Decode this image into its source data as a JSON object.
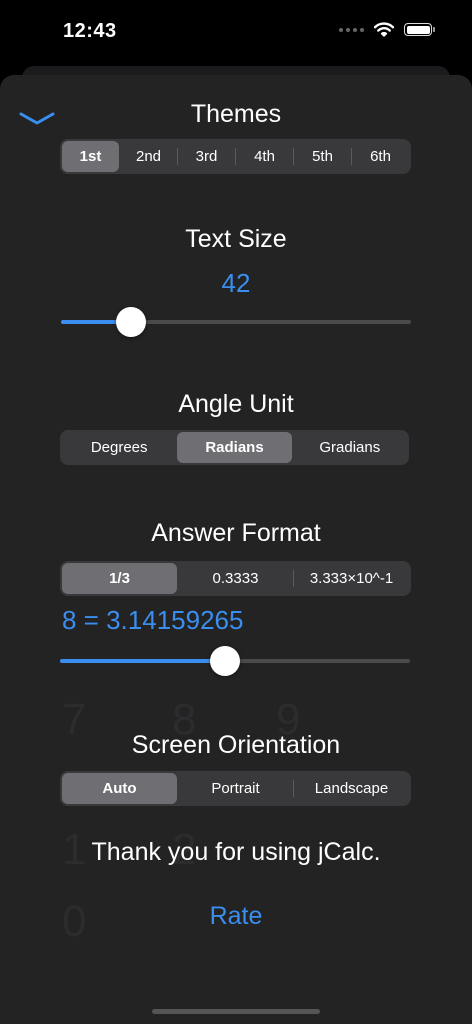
{
  "status_bar": {
    "time": "12:43"
  },
  "themes": {
    "title": "Themes",
    "options": [
      "1st",
      "2nd",
      "3rd",
      "4th",
      "5th",
      "6th"
    ],
    "selected_index": 0
  },
  "text_size": {
    "title": "Text Size",
    "value": "42",
    "slider_fraction": 0.2
  },
  "angle_unit": {
    "title": "Angle Unit",
    "options": [
      "Degrees",
      "Radians",
      "Gradians"
    ],
    "selected_index": 1
  },
  "answer_format": {
    "title": "Answer Format",
    "options": [
      "1/3",
      "0.3333",
      "3.333×10^-1"
    ],
    "selected_index": 0,
    "precision_label": "8 = 3.14159265",
    "slider_fraction": 0.47
  },
  "screen_orientation": {
    "title": "Screen Orientation",
    "options": [
      "Auto",
      "Portrait",
      "Landscape"
    ],
    "selected_index": 0
  },
  "footer": {
    "thanks": "Thank you for using jCalc.",
    "rate_label": "Rate"
  },
  "colors": {
    "accent": "#3a8ef0",
    "sheet_background": "#232324",
    "segment_background": "#39393b",
    "segment_selected": "#6f6f73"
  }
}
